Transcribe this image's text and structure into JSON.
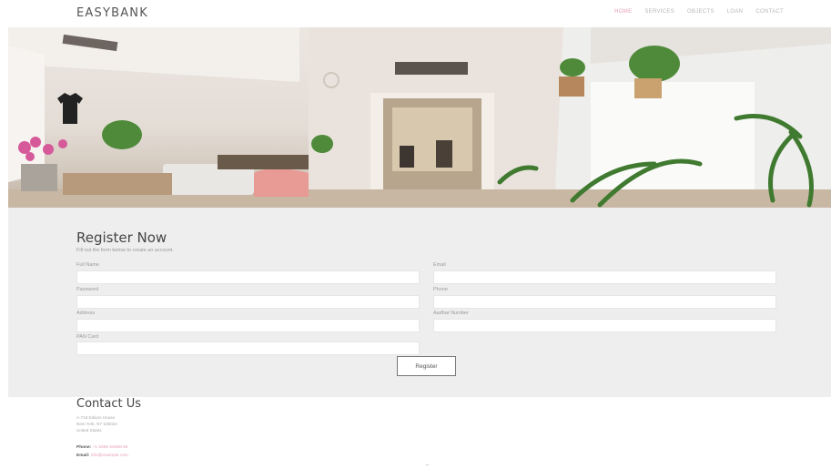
{
  "header": {
    "logo": "EASYBANK",
    "nav": [
      {
        "label": "HOME",
        "active": true
      },
      {
        "label": "SERVICES",
        "active": false
      },
      {
        "label": "OBJECTS",
        "active": false
      },
      {
        "label": "LOAN",
        "active": false
      },
      {
        "label": "CONTACT",
        "active": false
      }
    ]
  },
  "hero": {
    "alt": "office lounge with plants"
  },
  "register": {
    "title": "Register Now",
    "subtitle": "Fill out the form below to create an account.",
    "fields": {
      "full_name": {
        "label": "Full Name",
        "value": ""
      },
      "email": {
        "label": "Email",
        "value": ""
      },
      "password": {
        "label": "Password",
        "value": ""
      },
      "phone": {
        "label": "Phone",
        "value": ""
      },
      "address": {
        "label": "Address",
        "value": ""
      },
      "aadhar": {
        "label": "Aadhar Number",
        "value": ""
      },
      "pan": {
        "label": "PAN Card",
        "value": ""
      }
    },
    "button_label": "Register"
  },
  "contact": {
    "title": "Contact Us",
    "address_lines": [
      "A-718 Edison House",
      "New York, NY 535022",
      "United States"
    ],
    "phone_label": "Phone:",
    "phone_value": "+1 5589 55488 55",
    "email_label": "Email:",
    "email_value": "info@example.com"
  },
  "colors": {
    "accent": "#e5a3b8",
    "band": "#eeeeee"
  }
}
